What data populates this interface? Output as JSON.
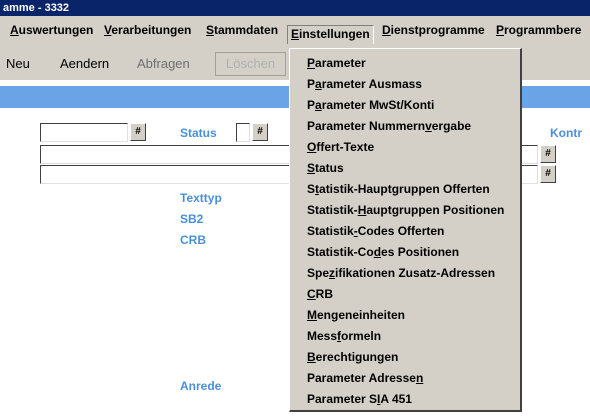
{
  "window": {
    "title": "amme - 3332"
  },
  "menubar": {
    "items": [
      {
        "pre": "",
        "key": "A",
        "post": "uswertungen"
      },
      {
        "pre": "",
        "key": "V",
        "post": "erarbeitungen"
      },
      {
        "pre": "",
        "key": "S",
        "post": "tammdaten"
      },
      {
        "pre": "",
        "key": "E",
        "post": "instellungen"
      },
      {
        "pre": "",
        "key": "D",
        "post": "ienstprogramme"
      },
      {
        "pre": "",
        "key": "P",
        "post": "rogrammbere"
      }
    ]
  },
  "toolbar": {
    "neu": "Neu",
    "aendern": "Aendern",
    "abfragen": "Abfragen",
    "loeschen": "Löschen"
  },
  "form": {
    "status_label": "Status",
    "kontr_label": "Kontr",
    "texttyp_label": "Texttyp",
    "sb2_label": "SB2",
    "crb_label": "CRB",
    "anrede_label": "Anrede",
    "lookup_glyph": "#"
  },
  "dropdown": {
    "items": [
      {
        "pre": "",
        "key": "P",
        "post": "arameter"
      },
      {
        "pre": "P",
        "key": "a",
        "post": "rameter Ausmass"
      },
      {
        "pre": "P",
        "key": "a",
        "post": "rameter MwSt/Konti"
      },
      {
        "pre": "Parameter Nummern",
        "key": "v",
        "post": "ergabe"
      },
      {
        "pre": "",
        "key": "O",
        "post": "ffert-Texte"
      },
      {
        "pre": "",
        "key": "S",
        "post": "tatus"
      },
      {
        "pre": "S",
        "key": "t",
        "post": "atistik-Hauptgruppen Offerten"
      },
      {
        "pre": "Statistik-",
        "key": "H",
        "post": "auptgruppen Positionen"
      },
      {
        "pre": "Statistik",
        "key": "-",
        "post": "Codes Offerten"
      },
      {
        "pre": "Statistik-Co",
        "key": "d",
        "post": "es Positionen"
      },
      {
        "pre": "Spe",
        "key": "z",
        "post": "ifikationen Zusatz-Adressen"
      },
      {
        "pre": "",
        "key": "C",
        "post": "RB"
      },
      {
        "pre": "",
        "key": "M",
        "post": "engeneinheiten"
      },
      {
        "pre": "Mess",
        "key": "f",
        "post": "ormeln"
      },
      {
        "pre": "",
        "key": "B",
        "post": "erechtigungen"
      },
      {
        "pre": "Parameter Adresse",
        "key": "n",
        "post": ""
      },
      {
        "pre": "Parameter S",
        "key": "I",
        "post": "A 451"
      }
    ]
  }
}
